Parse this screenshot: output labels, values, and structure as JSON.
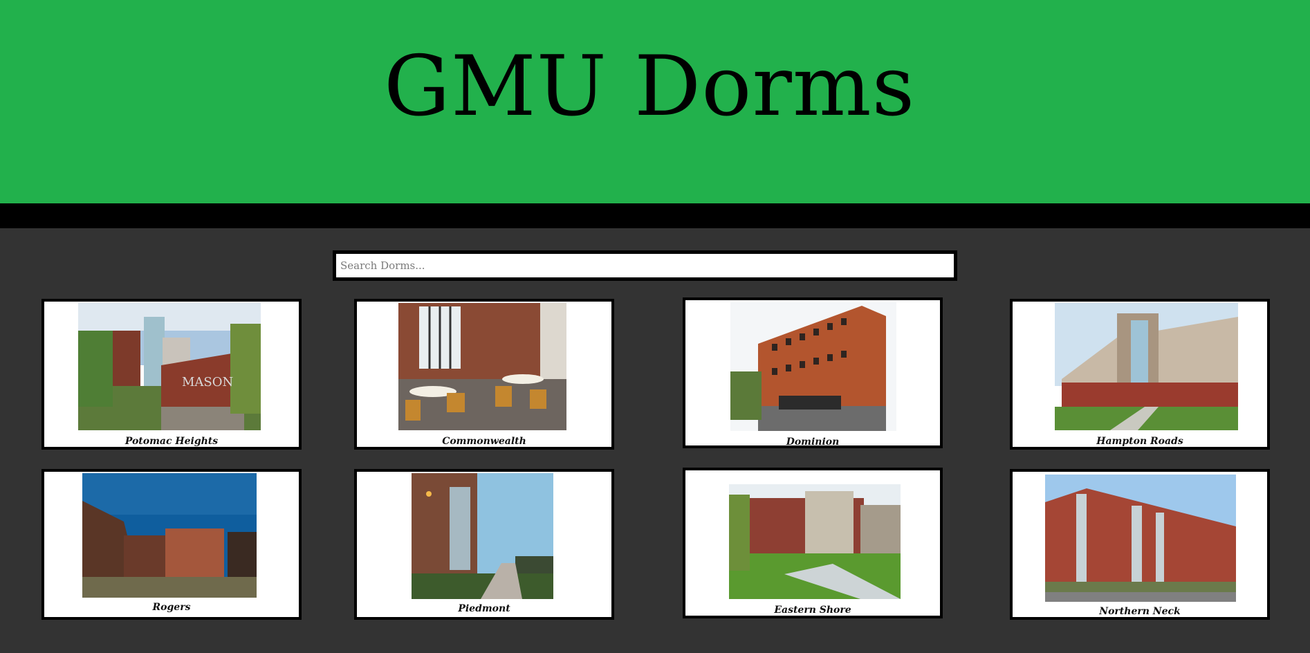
{
  "header": {
    "title": "GMU Dorms",
    "background": "#22b14c"
  },
  "search": {
    "placeholder": "Search Dorms...",
    "value": ""
  },
  "dorms": [
    {
      "name": "Potomac Heights"
    },
    {
      "name": "Commonwealth"
    },
    {
      "name": "Dominion"
    },
    {
      "name": "Hampton Roads"
    },
    {
      "name": "Rogers"
    },
    {
      "name": "Piedmont"
    },
    {
      "name": "Eastern Shore"
    },
    {
      "name": "Northern Neck"
    }
  ]
}
